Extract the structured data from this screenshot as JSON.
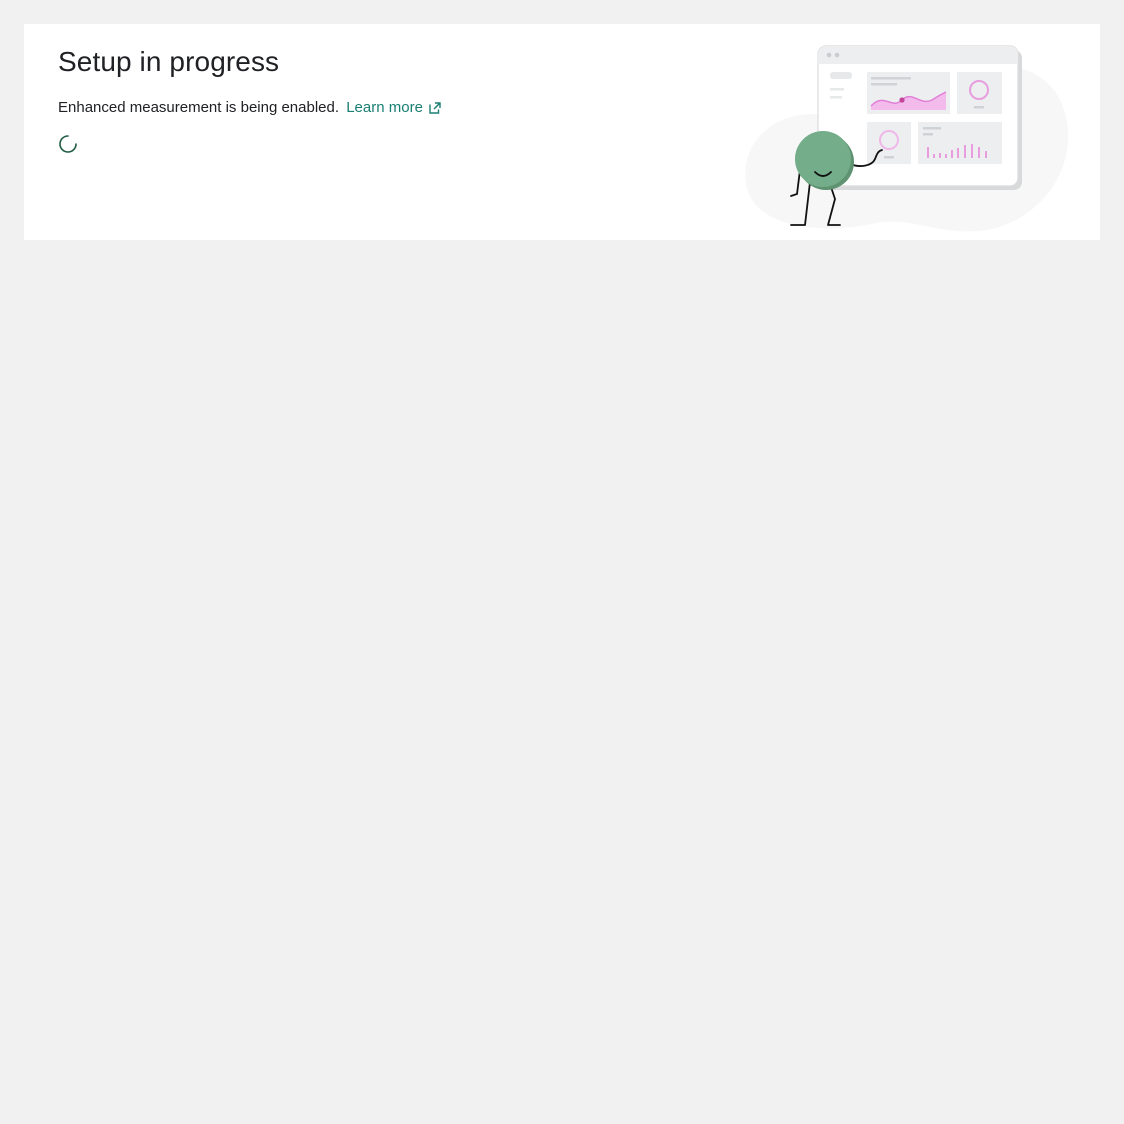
{
  "setup": {
    "title": "Setup in progress",
    "description": "Enhanced measurement is being enabled.",
    "learn_more_label": "Learn more"
  },
  "colors": {
    "link": "#1a7f73",
    "spinner": "#1e5b42",
    "character": "#74ad8a",
    "chart_accent": "#e07fd6"
  },
  "icons": {
    "external_link": "open-in-new-icon",
    "loading": "loading-spinner-icon"
  }
}
